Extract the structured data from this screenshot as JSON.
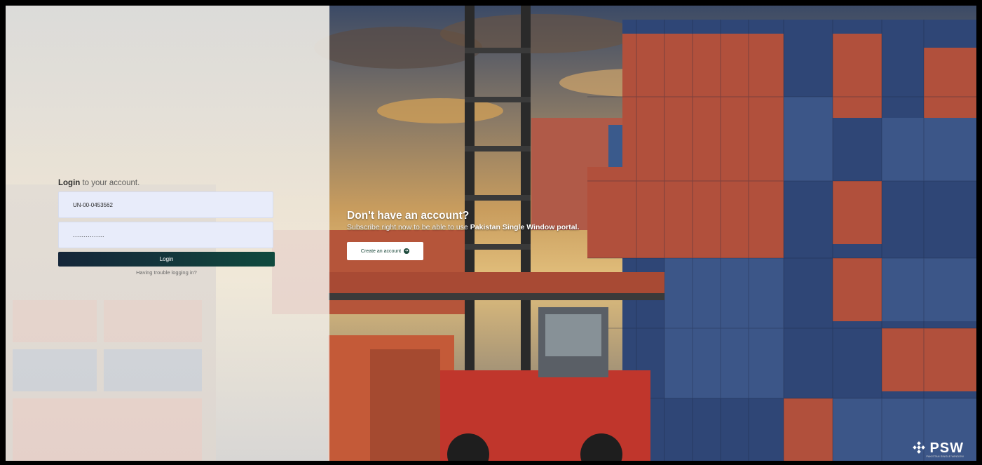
{
  "login": {
    "heading_bold": "Login",
    "heading_rest": " to your account.",
    "user_id_value": "UN-00-0453562",
    "password_value": "...............",
    "login_button": "Login",
    "trouble_link": "Having trouble logging in?"
  },
  "promo": {
    "title": "Don't have an account?",
    "subtitle_prefix": "Subscribe right now to be able to use ",
    "subtitle_bold": "Pakistan Single Window portal.",
    "create_button": "Create an account",
    "create_icon": "arrow-circle-right-icon"
  },
  "brand": {
    "logo_text": "PSW",
    "logo_tagline": "PAKISTAN SINGLE WINDOW",
    "logo_icon": "psw-dots-icon"
  },
  "colors": {
    "login_button": "#133a3c",
    "field_bg": "#e8ecfa",
    "accent": "#1d4a3c"
  }
}
